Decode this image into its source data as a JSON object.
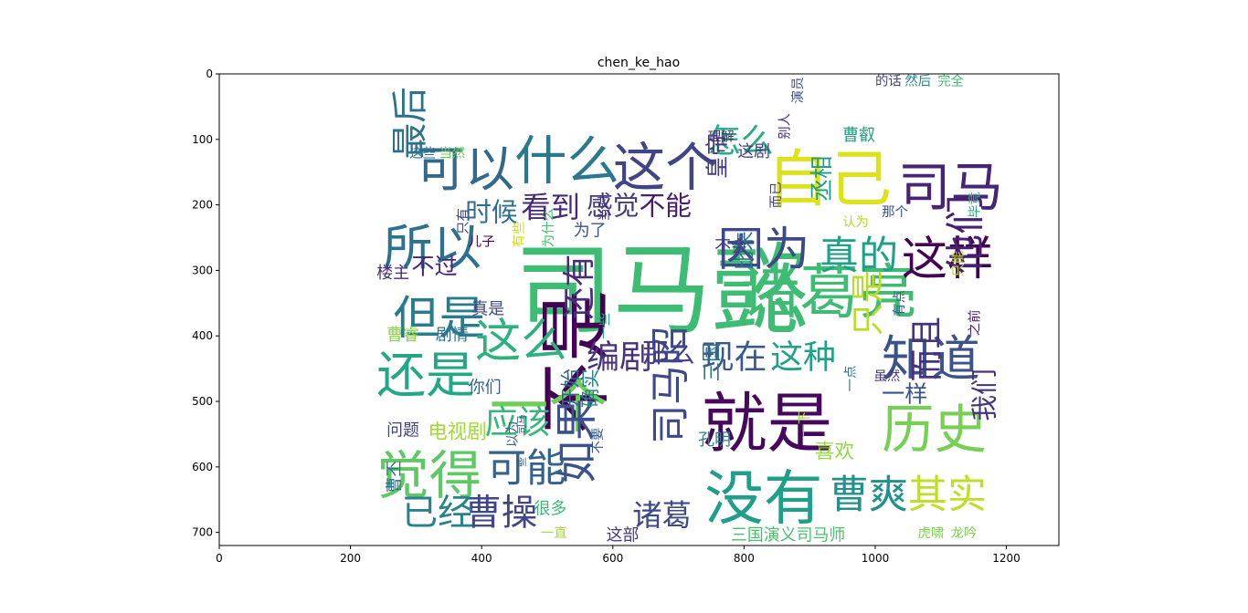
{
  "chart_data": {
    "type": "wordcloud",
    "title": "chen_ke_hao",
    "xlim": [
      0,
      1280
    ],
    "ylim": [
      720,
      0
    ],
    "x_ticks": [
      0,
      200,
      400,
      600,
      800,
      1000,
      1200
    ],
    "y_ticks": [
      0,
      100,
      200,
      300,
      400,
      500,
      600,
      700
    ],
    "words": [
      {
        "text": "司马懿",
        "x": 450,
        "y": 250,
        "size": 150,
        "color": "#3dbc74",
        "rot": 0
      },
      {
        "text": "诸葛亮",
        "x": 795,
        "y": 285,
        "size": 90,
        "color": "#3fbc73",
        "rot": 0
      },
      {
        "text": "就是",
        "x": 735,
        "y": 480,
        "size": 100,
        "color": "#46085c",
        "rot": 0
      },
      {
        "text": "不是",
        "x": 500,
        "y": 550,
        "size": 110,
        "color": "#440154",
        "rot": 90
      },
      {
        "text": "自己",
        "x": 835,
        "y": 110,
        "size": 95,
        "color": "#dde318",
        "rot": 0
      },
      {
        "text": "没有",
        "x": 740,
        "y": 600,
        "size": 90,
        "color": "#1f9e89",
        "rot": 0
      },
      {
        "text": "一个",
        "x": 412,
        "y": 460,
        "size": 90,
        "color": "#6ece58",
        "rot": 0
      },
      {
        "text": "历史",
        "x": 1010,
        "y": 500,
        "size": 80,
        "color": "#75d054",
        "rot": 0
      },
      {
        "text": "觉得",
        "x": 240,
        "y": 570,
        "size": 80,
        "color": "#5ec962",
        "rot": 0
      },
      {
        "text": "这个",
        "x": 600,
        "y": 100,
        "size": 80,
        "color": "#414487",
        "rot": 0
      },
      {
        "text": "司马",
        "x": 1035,
        "y": 130,
        "size": 80,
        "color": "#482475",
        "rot": 0
      },
      {
        "text": "什么",
        "x": 450,
        "y": 90,
        "size": 80,
        "color": "#2a788e",
        "rot": 0
      },
      {
        "text": "可以",
        "x": 300,
        "y": 105,
        "size": 75,
        "color": "#31688e",
        "rot": 0
      },
      {
        "text": "还是",
        "x": 240,
        "y": 420,
        "size": 75,
        "color": "#22a884",
        "rot": 0
      },
      {
        "text": "所以",
        "x": 250,
        "y": 225,
        "size": 75,
        "color": "#2c728e",
        "rot": 0
      },
      {
        "text": "但是",
        "x": 265,
        "y": 335,
        "size": 70,
        "color": "#287c8e",
        "rot": 0
      },
      {
        "text": "知道",
        "x": 1010,
        "y": 395,
        "size": 75,
        "color": "#3b528b",
        "rot": 0
      },
      {
        "text": "这么",
        "x": 390,
        "y": 370,
        "size": 70,
        "color": "#2db27d",
        "rot": 0
      },
      {
        "text": "这样",
        "x": 1040,
        "y": 245,
        "size": 70,
        "color": "#440154",
        "rot": 0
      },
      {
        "text": "因为",
        "x": 760,
        "y": 230,
        "size": 70,
        "color": "#3e4989",
        "rot": 0
      },
      {
        "text": "真的",
        "x": 915,
        "y": 245,
        "size": 60,
        "color": "#1fa187",
        "rot": 0
      },
      {
        "text": "曹爽",
        "x": 930,
        "y": 610,
        "size": 60,
        "color": "#21918c",
        "rot": 0
      },
      {
        "text": "其实",
        "x": 1050,
        "y": 610,
        "size": 60,
        "color": "#bddf26",
        "rot": 0
      },
      {
        "text": "如果",
        "x": 520,
        "y": 625,
        "size": 65,
        "color": "#3b528b",
        "rot": 90
      },
      {
        "text": "司马昭",
        "x": 665,
        "y": 565,
        "size": 60,
        "color": "#3e4989",
        "rot": 90
      },
      {
        "text": "可能",
        "x": 408,
        "y": 570,
        "size": 60,
        "color": "#33638d",
        "rot": 0
      },
      {
        "text": "曹操",
        "x": 375,
        "y": 640,
        "size": 55,
        "color": "#404688",
        "rot": 0
      },
      {
        "text": "已经",
        "x": 278,
        "y": 640,
        "size": 55,
        "color": "#26828e",
        "rot": 0
      },
      {
        "text": "应该",
        "x": 405,
        "y": 505,
        "size": 50,
        "color": "#35b779",
        "rot": 0
      },
      {
        "text": "编剧",
        "x": 560,
        "y": 405,
        "size": 50,
        "color": "#46327e",
        "rot": 0
      },
      {
        "text": "现在",
        "x": 735,
        "y": 405,
        "size": 50,
        "color": "#38598c",
        "rot": 0
      },
      {
        "text": "这种",
        "x": 840,
        "y": 405,
        "size": 50,
        "color": "#1fa187",
        "rot": 0
      },
      {
        "text": "还有",
        "x": 530,
        "y": 375,
        "size": 50,
        "color": "#472c7a",
        "rot": 90
      },
      {
        "text": "感觉",
        "x": 560,
        "y": 180,
        "size": 40,
        "color": "#443983",
        "rot": 0
      },
      {
        "text": "不能",
        "x": 640,
        "y": 180,
        "size": 40,
        "color": "#481f70",
        "rot": 0
      },
      {
        "text": "看到",
        "x": 460,
        "y": 180,
        "size": 45,
        "color": "#482878",
        "rot": 0
      },
      {
        "text": "时候",
        "x": 375,
        "y": 190,
        "size": 40,
        "color": "#2e6e8e",
        "rot": 0
      },
      {
        "text": "怎么",
        "x": 745,
        "y": 75,
        "size": 50,
        "color": "#27ad81",
        "rot": 0
      },
      {
        "text": "他们",
        "x": 1115,
        "y": 305,
        "size": 60,
        "color": "#482071",
        "rot": 90
      },
      {
        "text": "最后",
        "x": 270,
        "y": 130,
        "size": 55,
        "color": "#2c728e",
        "rot": 90
      },
      {
        "text": "只是",
        "x": 970,
        "y": 400,
        "size": 50,
        "color": "#b5de2b",
        "rot": 90
      },
      {
        "text": "而且",
        "x": 1060,
        "y": 470,
        "size": 50,
        "color": "#46337f",
        "rot": 90
      },
      {
        "text": "我们",
        "x": 1150,
        "y": 530,
        "size": 40,
        "color": "#46327e",
        "rot": 90
      },
      {
        "text": "诸葛",
        "x": 630,
        "y": 650,
        "size": 45,
        "color": "#3e4989",
        "rot": 0
      },
      {
        "text": "皇帝",
        "x": 745,
        "y": 160,
        "size": 35,
        "color": "#443a83",
        "rot": 90
      },
      {
        "text": "丞相",
        "x": 905,
        "y": 195,
        "size": 35,
        "color": "#1e9b8a",
        "rot": 90
      },
      {
        "text": "那么",
        "x": 645,
        "y": 405,
        "size": 40,
        "color": "#433e85",
        "rot": 0
      },
      {
        "text": "喜欢",
        "x": 908,
        "y": 560,
        "size": 30,
        "color": "#93d741",
        "rot": 0
      },
      {
        "text": "一样",
        "x": 1010,
        "y": 470,
        "size": 35,
        "color": "#39568c",
        "rot": 0
      },
      {
        "text": "不过",
        "x": 293,
        "y": 275,
        "size": 35,
        "color": "#482677",
        "rot": 0
      },
      {
        "text": "比来",
        "x": 790,
        "y": 300,
        "size": 30,
        "color": "#2d708e",
        "rot": 90
      },
      {
        "text": "开始",
        "x": 525,
        "y": 510,
        "size": 30,
        "color": "#31688e",
        "rot": 90
      },
      {
        "text": "确实",
        "x": 555,
        "y": 510,
        "size": 30,
        "color": "#25848e",
        "rot": 90
      },
      {
        "text": "三国",
        "x": 740,
        "y": 470,
        "size": 30,
        "color": "#2a788e",
        "rot": 90
      },
      {
        "text": "电视剧",
        "x": 318,
        "y": 530,
        "size": 30,
        "color": "#a0da39",
        "rot": 0
      },
      {
        "text": "问题",
        "x": 255,
        "y": 530,
        "size": 25,
        "color": "#414487",
        "rot": 0
      },
      {
        "text": "很多",
        "x": 480,
        "y": 650,
        "size": 25,
        "color": "#3aba76",
        "rot": 0
      },
      {
        "text": "这部",
        "x": 590,
        "y": 690,
        "size": 25,
        "color": "#453781",
        "rot": 0
      },
      {
        "text": "三国演义司马师",
        "x": 780,
        "y": 690,
        "size": 25,
        "color": "#4ac16d",
        "rot": 0
      },
      {
        "text": "孔明",
        "x": 730,
        "y": 545,
        "size": 25,
        "color": "#25858e",
        "rot": 0
      },
      {
        "text": "曹叡",
        "x": 950,
        "y": 80,
        "size": 25,
        "color": "#1fa187",
        "rot": 0
      },
      {
        "text": "这剧",
        "x": 790,
        "y": 105,
        "size": 25,
        "color": "#433d84",
        "rot": 0
      },
      {
        "text": "曹睿",
        "x": 255,
        "y": 385,
        "size": 25,
        "color": "#89d548",
        "rot": 0
      },
      {
        "text": "剧情",
        "x": 330,
        "y": 385,
        "size": 25,
        "color": "#2b748e",
        "rot": 0
      },
      {
        "text": "真是",
        "x": 385,
        "y": 345,
        "size": 25,
        "color": "#3e4989",
        "rot": 0
      },
      {
        "text": "你们",
        "x": 380,
        "y": 465,
        "size": 25,
        "color": "#34618d",
        "rot": 0
      },
      {
        "text": "为了",
        "x": 540,
        "y": 225,
        "size": 25,
        "color": "#3b528b",
        "rot": 0
      },
      {
        "text": "楼主",
        "x": 240,
        "y": 290,
        "size": 25,
        "color": "#472d7b",
        "rot": 0
      },
      {
        "text": "虎啸",
        "x": 1065,
        "y": 690,
        "size": 20,
        "color": "#7ad151",
        "rot": 0
      },
      {
        "text": "龙吟",
        "x": 1115,
        "y": 690,
        "size": 20,
        "color": "#7ad151",
        "rot": 0
      },
      {
        "text": "这些",
        "x": 290,
        "y": 110,
        "size": 20,
        "color": "#2c728e",
        "rot": 0
      },
      {
        "text": "当然",
        "x": 335,
        "y": 110,
        "size": 20,
        "color": "#6ece58",
        "rot": 0
      },
      {
        "text": "理解",
        "x": 745,
        "y": 85,
        "size": 20,
        "color": "#482878",
        "rot": 0
      },
      {
        "text": "别人",
        "x": 855,
        "y": 100,
        "size": 20,
        "color": "#472d7b",
        "rot": 90
      },
      {
        "text": "演员",
        "x": 875,
        "y": 45,
        "size": 20,
        "color": "#3b528b",
        "rot": 90
      },
      {
        "text": "的话",
        "x": 1000,
        "y": 0,
        "size": 20,
        "color": "#404688",
        "rot": 0
      },
      {
        "text": "然后",
        "x": 1045,
        "y": 0,
        "size": 20,
        "color": "#25858e",
        "rot": 0
      },
      {
        "text": "完全",
        "x": 1095,
        "y": 0,
        "size": 20,
        "color": "#3dbc74",
        "rot": 0
      },
      {
        "text": "不会",
        "x": 755,
        "y": 250,
        "size": 25,
        "color": "#443983",
        "rot": 0
      },
      {
        "text": "而已",
        "x": 842,
        "y": 205,
        "size": 20,
        "color": "#433e85",
        "rot": 90
      },
      {
        "text": "那个",
        "x": 1010,
        "y": 200,
        "size": 20,
        "color": "#3b528b",
        "rot": 0
      },
      {
        "text": "认为",
        "x": 950,
        "y": 215,
        "size": 20,
        "color": "#b5de2b",
        "rot": 0
      },
      {
        "text": "毕竟",
        "x": 1145,
        "y": 220,
        "size": 20,
        "color": "#2db27d",
        "rot": 90
      },
      {
        "text": "只能",
        "x": 1120,
        "y": 310,
        "size": 20,
        "color": "#b8de29",
        "rot": 90
      },
      {
        "text": "之前",
        "x": 1145,
        "y": 400,
        "size": 20,
        "color": "#482173",
        "rot": 90
      },
      {
        "text": "有点",
        "x": 1030,
        "y": 370,
        "size": 20,
        "color": "#33638d",
        "rot": 90
      },
      {
        "text": "虽然",
        "x": 998,
        "y": 450,
        "size": 20,
        "color": "#453882",
        "rot": 0
      },
      {
        "text": "一点",
        "x": 955,
        "y": 485,
        "size": 20,
        "color": "#2a788e",
        "rot": 90
      },
      {
        "text": "一下",
        "x": 885,
        "y": 555,
        "size": 20,
        "color": "#a5db36",
        "rot": 90
      },
      {
        "text": "一直",
        "x": 490,
        "y": 690,
        "size": 20,
        "color": "#a8db34",
        "rot": 0
      },
      {
        "text": "曹丕",
        "x": 257,
        "y": 640,
        "size": 25,
        "color": "#2e6f8e",
        "rot": 90
      },
      {
        "text": "以为",
        "x": 440,
        "y": 570,
        "size": 20,
        "color": "#33638d",
        "rot": 90
      },
      {
        "text": "不要",
        "x": 570,
        "y": 580,
        "size": 20,
        "color": "#375b8d",
        "rot": 90
      },
      {
        "text": "司马",
        "x": 455,
        "y": 550,
        "size": 15,
        "color": "#3b528b",
        "rot": 90
      },
      {
        "text": "些",
        "x": 455,
        "y": 600,
        "size": 15,
        "color": "#3b528b",
        "rot": 90
      },
      {
        "text": "只有",
        "x": 365,
        "y": 245,
        "size": 20,
        "color": "#404387",
        "rot": 90
      },
      {
        "text": "儿子",
        "x": 380,
        "y": 245,
        "size": 20,
        "color": "#440154",
        "rot": 0
      },
      {
        "text": "有些",
        "x": 450,
        "y": 265,
        "size": 20,
        "color": "#d2e21b",
        "rot": 90
      },
      {
        "text": "为什么",
        "x": 495,
        "y": 265,
        "size": 20,
        "color": "#4ac16d",
        "rot": 90
      },
      {
        "text": "当时",
        "x": 580,
        "y": 225,
        "size": 20,
        "color": "#46337f",
        "rot": 90
      },
      {
        "text": "一些",
        "x": 580,
        "y": 405,
        "size": 20,
        "color": "#27ad81",
        "rot": 90
      }
    ]
  }
}
